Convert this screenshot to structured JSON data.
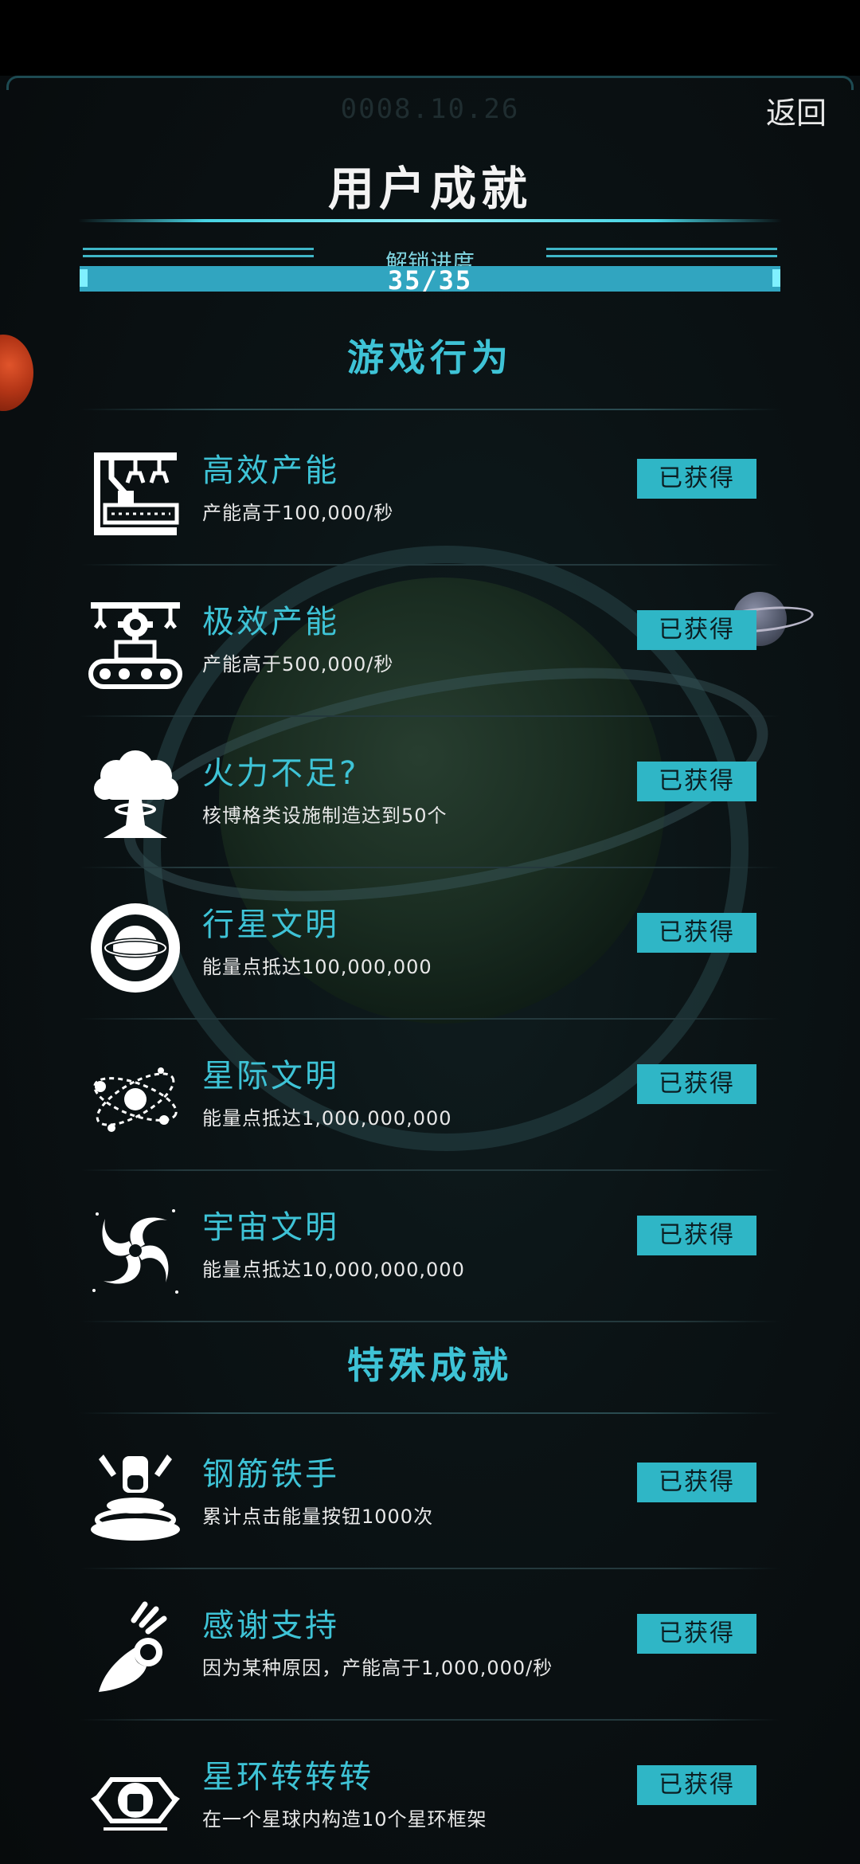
{
  "header": {
    "date": "0008.10.26",
    "back_label": "返回",
    "title": "用户成就"
  },
  "progress": {
    "label": "解锁进度",
    "text": "35/35",
    "fraction": 1.0
  },
  "sections": [
    {
      "title": "游戏行为",
      "achievements": [
        {
          "name": "高效产能",
          "desc": "产能高于100,000/秒",
          "status": "已获得",
          "icon": "factory-robot-arm-icon"
        },
        {
          "name": "极效产能",
          "desc": "产能高于500,000/秒",
          "status": "已获得",
          "icon": "gear-conveyor-robot-icon"
        },
        {
          "name": "火力不足?",
          "desc": "核博格类设施制造达到50个",
          "status": "已获得",
          "icon": "mushroom-cloud-icon"
        },
        {
          "name": "行星文明",
          "desc": "能量点抵达100,000,000",
          "status": "已获得",
          "icon": "planet-ring-icon"
        },
        {
          "name": "星际文明",
          "desc": "能量点抵达1,000,000,000",
          "status": "已获得",
          "icon": "orbits-icon"
        },
        {
          "name": "宇宙文明",
          "desc": "能量点抵达10,000,000,000",
          "status": "已获得",
          "icon": "galaxy-swirl-icon"
        }
      ]
    },
    {
      "title": "特殊成就",
      "achievements": [
        {
          "name": "钢筋铁手",
          "desc": "累计点击能量按钮1000次",
          "status": "已获得",
          "icon": "press-button-icon"
        },
        {
          "name": "感谢支持",
          "desc": "因为某种原因，产能高于1,000,000/秒",
          "status": "已获得",
          "icon": "ok-hand-icon"
        },
        {
          "name": "星环转转转",
          "desc": "在一个星球内构造10个星环框架",
          "status": "已获得",
          "icon": "ring-frame-icon"
        }
      ]
    }
  ],
  "colors": {
    "accent": "#3ec3d6",
    "button_bg": "#2fb6c6",
    "progress_fill": "#31a5c0",
    "background": "#0b1315"
  }
}
